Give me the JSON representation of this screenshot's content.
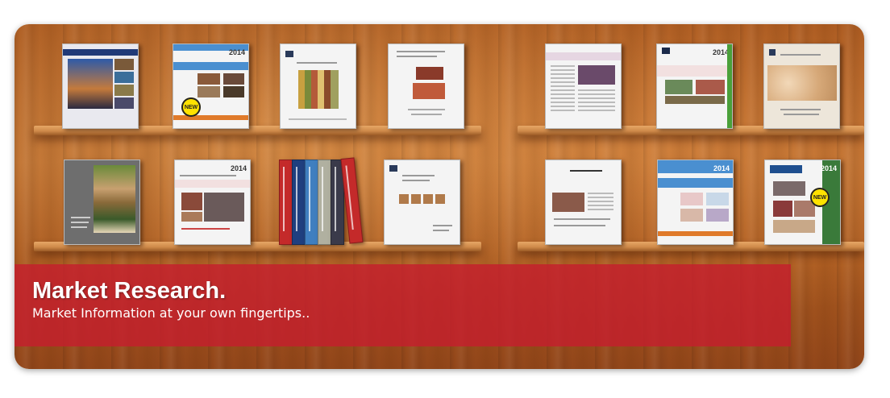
{
  "banner": {
    "title": "Market Research.",
    "subtitle": "Market Information at your own fingertips.."
  },
  "badges": {
    "new": "NEW"
  },
  "book_years": {
    "b2": "2014",
    "b10": "2014",
    "b7": "2014",
    "b12": "2014",
    "b13": "2014"
  },
  "colors": {
    "banner": "#c41e2d",
    "wood": "#a8571e",
    "shelf": "#cf8a4a"
  }
}
